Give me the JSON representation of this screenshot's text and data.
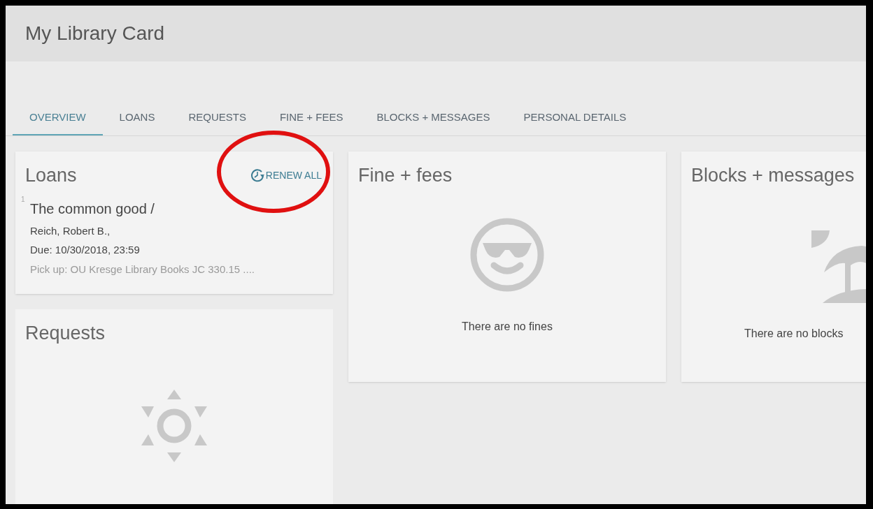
{
  "page_title": "My Library Card",
  "tabs": [
    {
      "label": "OVERVIEW",
      "selected": true
    },
    {
      "label": "LOANS",
      "selected": false
    },
    {
      "label": "REQUESTS",
      "selected": false
    },
    {
      "label": "FINE + FEES",
      "selected": false
    },
    {
      "label": "BLOCKS + MESSAGES",
      "selected": false
    },
    {
      "label": "PERSONAL DETAILS",
      "selected": false
    }
  ],
  "loans": {
    "title": "Loans",
    "renew_all": "RENEW ALL",
    "items": [
      {
        "number": "1",
        "title": "The common good /",
        "author": "Reich, Robert B.,",
        "due": "Due: 10/30/2018, 23:59",
        "pickup": "Pick up: OU Kresge Library Books JC 330.15 ...."
      }
    ]
  },
  "requests": {
    "title": "Requests"
  },
  "fines": {
    "title": "Fine + fees",
    "message": "There are no fines"
  },
  "blocks": {
    "title": "Blocks + messages",
    "message": "There are no blocks"
  }
}
